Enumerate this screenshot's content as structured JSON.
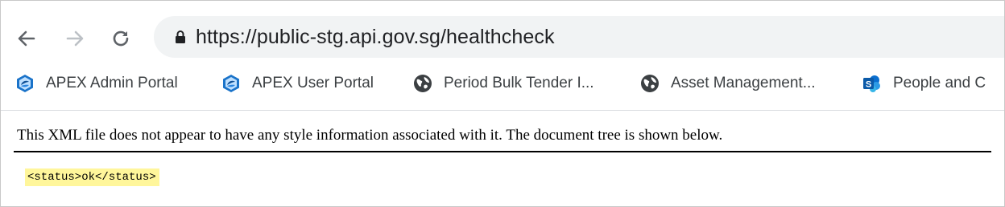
{
  "browser": {
    "url": "https://public-stg.api.gov.sg/healthcheck",
    "nav": {
      "back_icon": "arrow-left-icon",
      "forward_icon": "arrow-right-icon",
      "reload_icon": "reload-icon"
    }
  },
  "bookmarks": [
    {
      "label": "APEX Admin Portal",
      "icon": "apex-logo-icon"
    },
    {
      "label": "APEX User Portal",
      "icon": "apex-logo-icon"
    },
    {
      "label": "Period Bulk Tender I...",
      "icon": "globe-icon"
    },
    {
      "label": "Asset Management...",
      "icon": "globe-icon"
    },
    {
      "label": "People and C",
      "icon": "sharepoint-icon"
    }
  ],
  "page": {
    "xml_notice": "This XML file does not appear to have any style information associated with it. The document tree is shown below.",
    "xml_content": "<status>ok</status>"
  },
  "colors": {
    "omnibox_bg": "#f1f3f4",
    "xml_highlight": "#fff69b",
    "apex_blue": "#1a73c9",
    "sharepoint_blue": "#0a6fcf"
  }
}
